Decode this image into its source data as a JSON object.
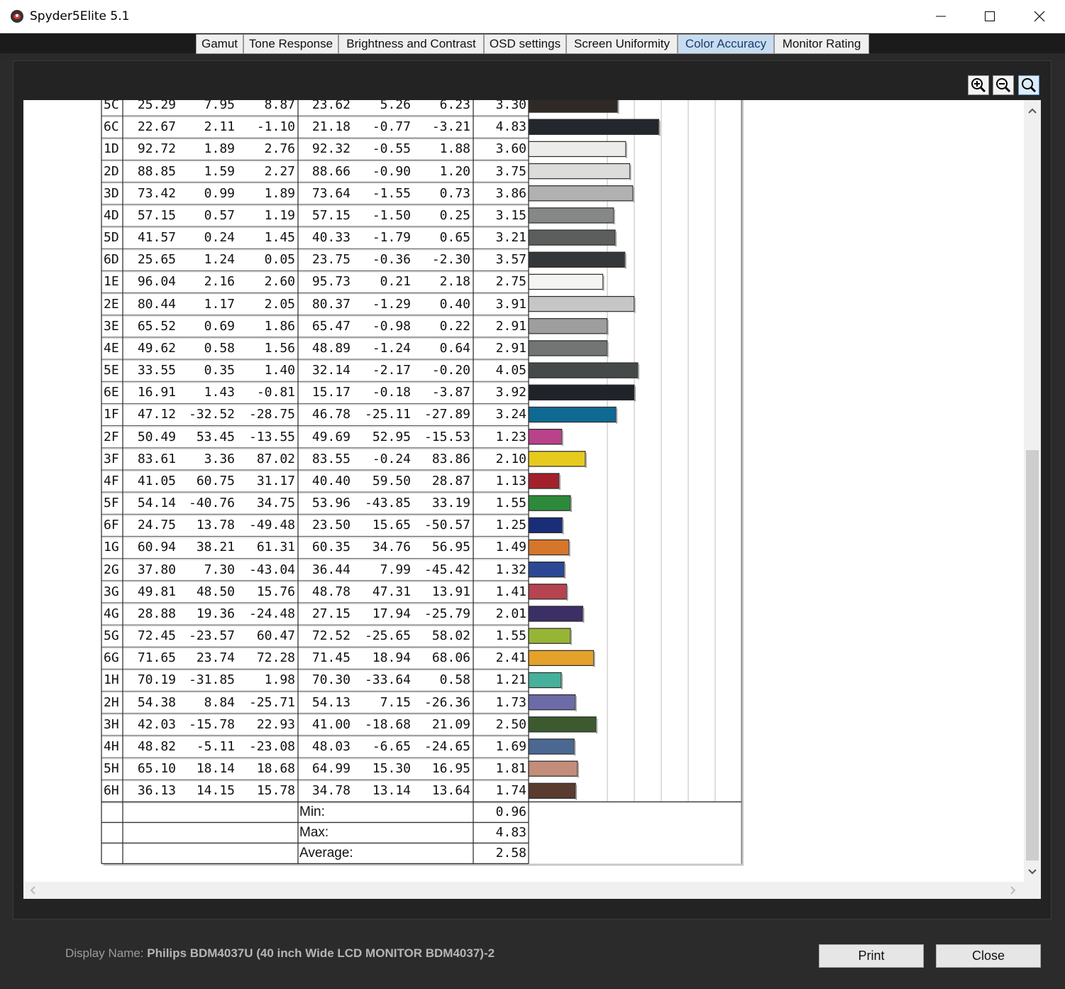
{
  "window": {
    "title": "Spyder5Elite 5.1"
  },
  "tabs": [
    {
      "label": "Gamut"
    },
    {
      "label": "Tone Response"
    },
    {
      "label": "Brightness and Contrast"
    },
    {
      "label": "OSD settings"
    },
    {
      "label": "Screen Uniformity"
    },
    {
      "label": "Color Accuracy",
      "active": true
    },
    {
      "label": "Monitor Rating"
    }
  ],
  "zoom_buttons": [
    {
      "name": "zoom-in-icon"
    },
    {
      "name": "zoom-out-icon"
    },
    {
      "name": "zoom-fit-icon",
      "active": true
    }
  ],
  "color_accuracy": {
    "columns": [
      "id",
      "ref_L",
      "ref_a",
      "ref_b",
      "meas_L",
      "meas_a",
      "meas_b",
      "delta_e"
    ],
    "rows": [
      {
        "id": "5C",
        "cells": [
          "25.29",
          "7.95",
          "8.87",
          "23.62",
          "5.26",
          "6.23",
          "3.30"
        ],
        "color": "#2f2a26"
      },
      {
        "id": "6C",
        "cells": [
          "22.67",
          "2.11",
          "-1.10",
          "21.18",
          "-0.77",
          "-3.21",
          "4.83"
        ],
        "color": "#23262c"
      },
      {
        "id": "1D",
        "cells": [
          "92.72",
          "1.89",
          "2.76",
          "92.32",
          "-0.55",
          "1.88",
          "3.60"
        ],
        "color": "#ececea"
      },
      {
        "id": "2D",
        "cells": [
          "88.85",
          "1.59",
          "2.27",
          "88.66",
          "-0.90",
          "1.20",
          "3.75"
        ],
        "color": "#dcdcdb"
      },
      {
        "id": "3D",
        "cells": [
          "73.42",
          "0.99",
          "1.89",
          "73.64",
          "-1.55",
          "0.73",
          "3.86"
        ],
        "color": "#b1b1b1"
      },
      {
        "id": "4D",
        "cells": [
          "57.15",
          "0.57",
          "1.19",
          "57.15",
          "-1.50",
          "0.25",
          "3.15"
        ],
        "color": "#868787"
      },
      {
        "id": "5D",
        "cells": [
          "41.57",
          "0.24",
          "1.45",
          "40.33",
          "-1.79",
          "0.65",
          "3.21"
        ],
        "color": "#5c5d5d"
      },
      {
        "id": "6D",
        "cells": [
          "25.65",
          "1.24",
          "0.05",
          "23.75",
          "-0.36",
          "-2.30",
          "3.57"
        ],
        "color": "#34373a"
      },
      {
        "id": "1E",
        "cells": [
          "96.04",
          "2.16",
          "2.60",
          "95.73",
          "0.21",
          "2.18",
          "2.75"
        ],
        "color": "#f4f4f2"
      },
      {
        "id": "2E",
        "cells": [
          "80.44",
          "1.17",
          "2.05",
          "80.37",
          "-1.29",
          "0.40",
          "3.91"
        ],
        "color": "#c5c6c6"
      },
      {
        "id": "3E",
        "cells": [
          "65.52",
          "0.69",
          "1.86",
          "65.47",
          "-0.98",
          "0.22",
          "2.91"
        ],
        "color": "#9e9e9e"
      },
      {
        "id": "4E",
        "cells": [
          "49.62",
          "0.58",
          "1.56",
          "48.89",
          "-1.24",
          "0.64",
          "2.91"
        ],
        "color": "#737474"
      },
      {
        "id": "5E",
        "cells": [
          "33.55",
          "0.35",
          "1.40",
          "32.14",
          "-2.17",
          "-0.20",
          "4.05"
        ],
        "color": "#46494a"
      },
      {
        "id": "6E",
        "cells": [
          "16.91",
          "1.43",
          "-0.81",
          "15.17",
          "-0.18",
          "-3.87",
          "3.92"
        ],
        "color": "#202329"
      },
      {
        "id": "1F",
        "cells": [
          "47.12",
          "-32.52",
          "-28.75",
          "46.78",
          "-25.11",
          "-27.89",
          "3.24"
        ],
        "color": "#0e6a93"
      },
      {
        "id": "2F",
        "cells": [
          "50.49",
          "53.45",
          "-13.55",
          "49.69",
          "52.95",
          "-15.53",
          "1.23"
        ],
        "color": "#b9428b"
      },
      {
        "id": "3F",
        "cells": [
          "83.61",
          "3.36",
          "87.02",
          "83.55",
          "-0.24",
          "83.86",
          "2.10"
        ],
        "color": "#e6cb1e"
      },
      {
        "id": "4F",
        "cells": [
          "41.05",
          "60.75",
          "31.17",
          "40.40",
          "59.50",
          "28.87",
          "1.13"
        ],
        "color": "#a3212b"
      },
      {
        "id": "5F",
        "cells": [
          "54.14",
          "-40.76",
          "34.75",
          "53.96",
          "-43.85",
          "33.19",
          "1.55"
        ],
        "color": "#2d8a3a"
      },
      {
        "id": "6F",
        "cells": [
          "24.75",
          "13.78",
          "-49.48",
          "23.50",
          "15.65",
          "-50.57",
          "1.25"
        ],
        "color": "#1a2d78"
      },
      {
        "id": "1G",
        "cells": [
          "60.94",
          "38.21",
          "61.31",
          "60.35",
          "34.76",
          "56.95",
          "1.49"
        ],
        "color": "#d6762a"
      },
      {
        "id": "2G",
        "cells": [
          "37.80",
          "7.30",
          "-43.04",
          "36.44",
          "7.99",
          "-45.42",
          "1.32"
        ],
        "color": "#2c4794"
      },
      {
        "id": "3G",
        "cells": [
          "49.81",
          "48.50",
          "15.76",
          "48.78",
          "47.31",
          "13.91",
          "1.41"
        ],
        "color": "#b54350"
      },
      {
        "id": "4G",
        "cells": [
          "28.88",
          "19.36",
          "-24.48",
          "27.15",
          "17.94",
          "-25.79",
          "2.01"
        ],
        "color": "#3b2f66"
      },
      {
        "id": "5G",
        "cells": [
          "72.45",
          "-23.57",
          "60.47",
          "72.52",
          "-25.65",
          "58.02",
          "1.55"
        ],
        "color": "#97b534"
      },
      {
        "id": "6G",
        "cells": [
          "71.65",
          "23.74",
          "72.28",
          "71.45",
          "18.94",
          "68.06",
          "2.41"
        ],
        "color": "#e4a22a"
      },
      {
        "id": "1H",
        "cells": [
          "70.19",
          "-31.85",
          "1.98",
          "70.30",
          "-33.64",
          "0.58",
          "1.21"
        ],
        "color": "#46b09a"
      },
      {
        "id": "2H",
        "cells": [
          "54.38",
          "8.84",
          "-25.71",
          "54.13",
          "7.15",
          "-26.36",
          "1.73"
        ],
        "color": "#6c6ba8"
      },
      {
        "id": "3H",
        "cells": [
          "42.03",
          "-15.78",
          "22.93",
          "41.00",
          "-18.68",
          "21.09",
          "2.50"
        ],
        "color": "#3c5a2e"
      },
      {
        "id": "4H",
        "cells": [
          "48.82",
          "-5.11",
          "-23.08",
          "48.03",
          "-6.65",
          "-24.65",
          "1.69"
        ],
        "color": "#4a6891"
      },
      {
        "id": "5H",
        "cells": [
          "65.10",
          "18.14",
          "18.68",
          "64.99",
          "15.30",
          "16.95",
          "1.81"
        ],
        "color": "#c38d7a"
      },
      {
        "id": "6H",
        "cells": [
          "36.13",
          "14.15",
          "15.78",
          "34.78",
          "13.14",
          "13.64",
          "1.74"
        ],
        "color": "#5a3b2f"
      }
    ],
    "summary": [
      {
        "label": "Min:",
        "value": "0.96"
      },
      {
        "label": "Max:",
        "value": "4.83"
      },
      {
        "label": "Average:",
        "value": "2.58"
      }
    ]
  },
  "footer": {
    "display_name_label": "Display Name: ",
    "display_name_value": "Philips BDM4037U (40 inch Wide LCD MONITOR BDM4037)-2",
    "print_label": "Print",
    "close_label": "Close"
  }
}
